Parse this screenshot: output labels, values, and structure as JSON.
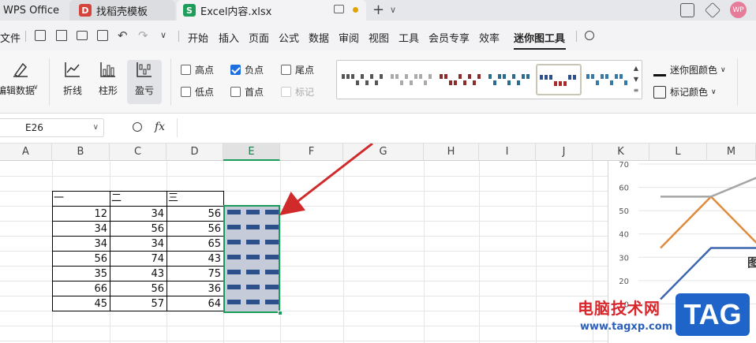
{
  "titlebar": {
    "app_tab": "WPS Office",
    "tabs": [
      {
        "label": "找稻壳模板"
      },
      {
        "label": "Excel内容.xlsx"
      }
    ],
    "avatar_text": "WP"
  },
  "menubar": {
    "file": "文件",
    "items": [
      "开始",
      "插入",
      "页面",
      "公式",
      "数据",
      "审阅",
      "视图",
      "工具",
      "会员专享",
      "效率",
      "迷你图工具"
    ],
    "active": "迷你图工具"
  },
  "ribbon": {
    "edit_data": "编辑数据",
    "types": [
      "折线",
      "柱形",
      "盈亏"
    ],
    "selected_type": "盈亏",
    "checks": [
      {
        "label": "高点",
        "checked": false,
        "disabled": false
      },
      {
        "label": "负点",
        "checked": true,
        "disabled": false
      },
      {
        "label": "尾点",
        "checked": false,
        "disabled": false
      },
      {
        "label": "低点",
        "checked": false,
        "disabled": false
      },
      {
        "label": "首点",
        "checked": false,
        "disabled": false
      },
      {
        "label": "标记",
        "checked": false,
        "disabled": true
      }
    ],
    "sparkline_color": "迷你图颜色",
    "marker_color": "标记颜色"
  },
  "formula": {
    "cell_ref": "E26",
    "fx": "fx",
    "value": ""
  },
  "grid": {
    "columns": [
      "A",
      "B",
      "C",
      "D",
      "E",
      "F",
      "G",
      "H",
      "I",
      "J",
      "K",
      "L",
      "M"
    ],
    "selected_column": "E",
    "headers": [
      "一",
      "二",
      "三"
    ],
    "rows": [
      [
        12,
        34,
        56
      ],
      [
        34,
        56,
        56
      ],
      [
        34,
        34,
        65
      ],
      [
        56,
        74,
        43
      ],
      [
        35,
        43,
        75
      ],
      [
        66,
        56,
        36
      ],
      [
        45,
        57,
        64
      ]
    ]
  },
  "chart_data": {
    "type": "line",
    "y_ticks": [
      10,
      20,
      30,
      40,
      50,
      60,
      70
    ],
    "ylim": [
      0,
      70
    ],
    "series": [
      {
        "values": [
          12,
          34,
          34
        ],
        "color": "#3d66b0"
      },
      {
        "values": [
          34,
          56,
          34
        ],
        "color": "#e08a3c"
      },
      {
        "values": [
          56,
          56,
          65
        ],
        "color": "#a5a5a5"
      }
    ],
    "title": "图"
  },
  "watermark": {
    "line1": "电脑技术网",
    "line2": "www.tagxp.com",
    "badge": "TAG"
  },
  "colors": {
    "selection": "#1a9c5b",
    "sparkline": "#2d4f8a",
    "arrow": "#d02a2a"
  }
}
